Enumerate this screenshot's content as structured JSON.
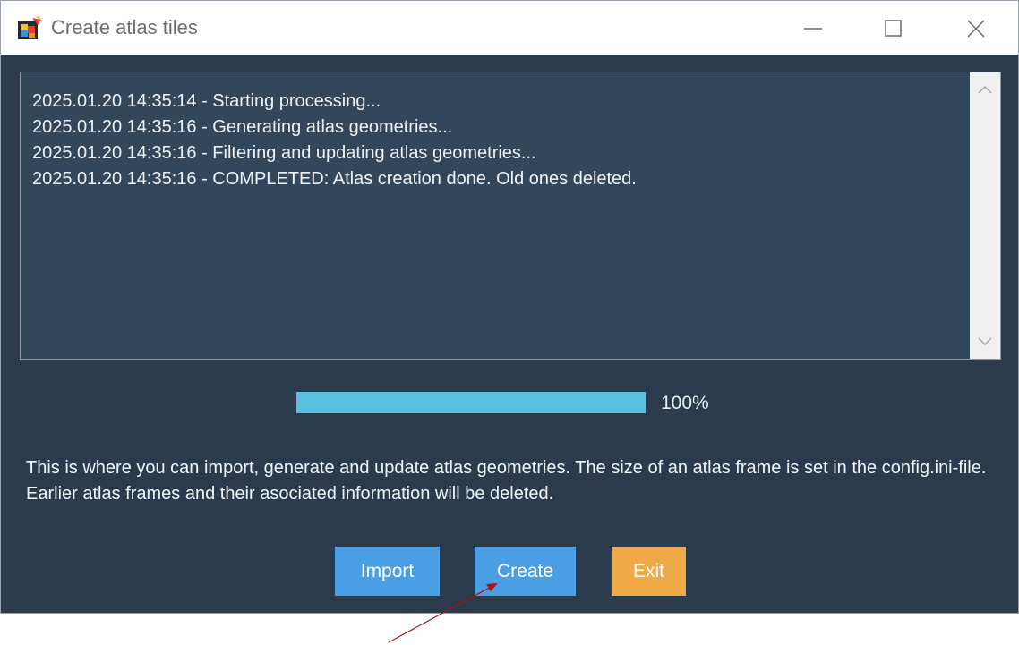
{
  "window": {
    "title": "Create atlas tiles",
    "icons": {
      "app": "app-logo-icon",
      "minimize": "minimize-icon",
      "maximize": "maximize-icon",
      "close": "close-icon"
    }
  },
  "log": {
    "lines": [
      "2025.01.20 14:35:14 - Starting processing...",
      "2025.01.20 14:35:16 - Generating atlas geometries...",
      "2025.01.20 14:35:16 - Filtering and updating atlas geometries...",
      "2025.01.20 14:35:16 - COMPLETED: Atlas creation done. Old ones deleted."
    ]
  },
  "progress": {
    "value": 1.0,
    "label": "100%",
    "color": "#5bc0de"
  },
  "description": "This is where you can import, generate and update atlas geometries. The size of an atlas frame is set in the config.ini-file. Earlier atlas frames and their asociated information will be deleted.",
  "buttons": {
    "import": "Import",
    "create": "Create",
    "exit": "Exit"
  },
  "colors": {
    "background": "#2b3a4c",
    "log_background": "#33475c",
    "primary_button": "#4a9ee3",
    "exit_button": "#eeaa48",
    "annotation_arrow": "#b01010"
  }
}
